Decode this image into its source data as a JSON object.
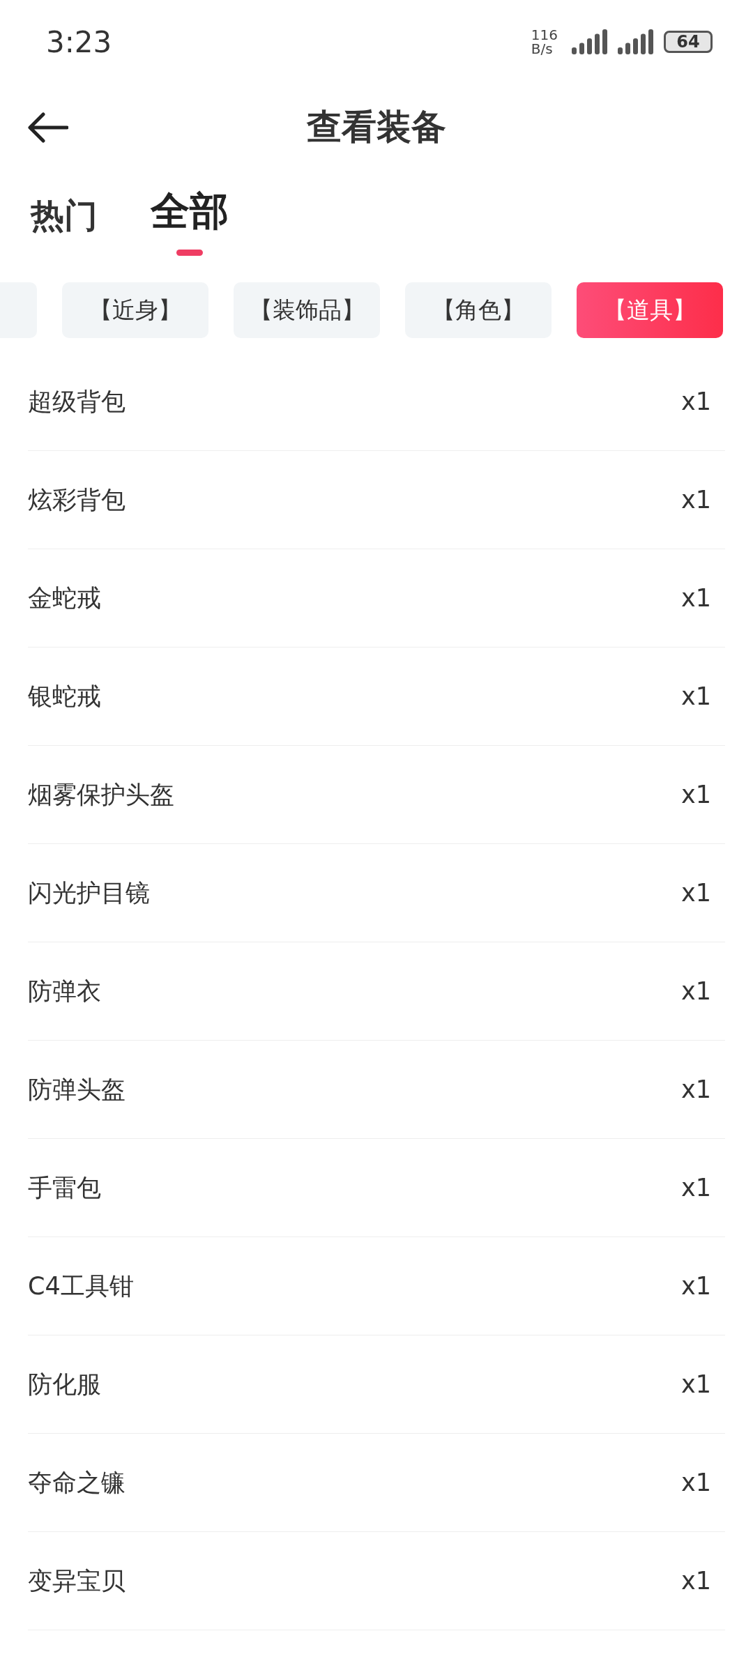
{
  "status_bar": {
    "time": "3:23",
    "net_speed": "116",
    "net_unit": "B/s",
    "battery": "64"
  },
  "header": {
    "title": "查看装备"
  },
  "tabs": [
    {
      "label": "热门",
      "selected": false
    },
    {
      "label": "全部",
      "selected": true
    }
  ],
  "filters": [
    {
      "label": "【近身】",
      "selected": false
    },
    {
      "label": "【装饰品】",
      "selected": false
    },
    {
      "label": "【角色】",
      "selected": false
    },
    {
      "label": "【道具】",
      "selected": true
    }
  ],
  "items": [
    {
      "name": "超级背包",
      "count": "x1"
    },
    {
      "name": "炫彩背包",
      "count": "x1"
    },
    {
      "name": "金蛇戒",
      "count": "x1"
    },
    {
      "name": "银蛇戒",
      "count": "x1"
    },
    {
      "name": "烟雾保护头盔",
      "count": "x1"
    },
    {
      "name": "闪光护目镜",
      "count": "x1"
    },
    {
      "name": "防弹衣",
      "count": "x1"
    },
    {
      "name": "防弹头盔",
      "count": "x1"
    },
    {
      "name": "手雷包",
      "count": "x1"
    },
    {
      "name": "C4工具钳",
      "count": "x1"
    },
    {
      "name": "防化服",
      "count": "x1"
    },
    {
      "name": "夺命之镰",
      "count": "x1"
    },
    {
      "name": "变异宝贝",
      "count": "x1"
    }
  ]
}
